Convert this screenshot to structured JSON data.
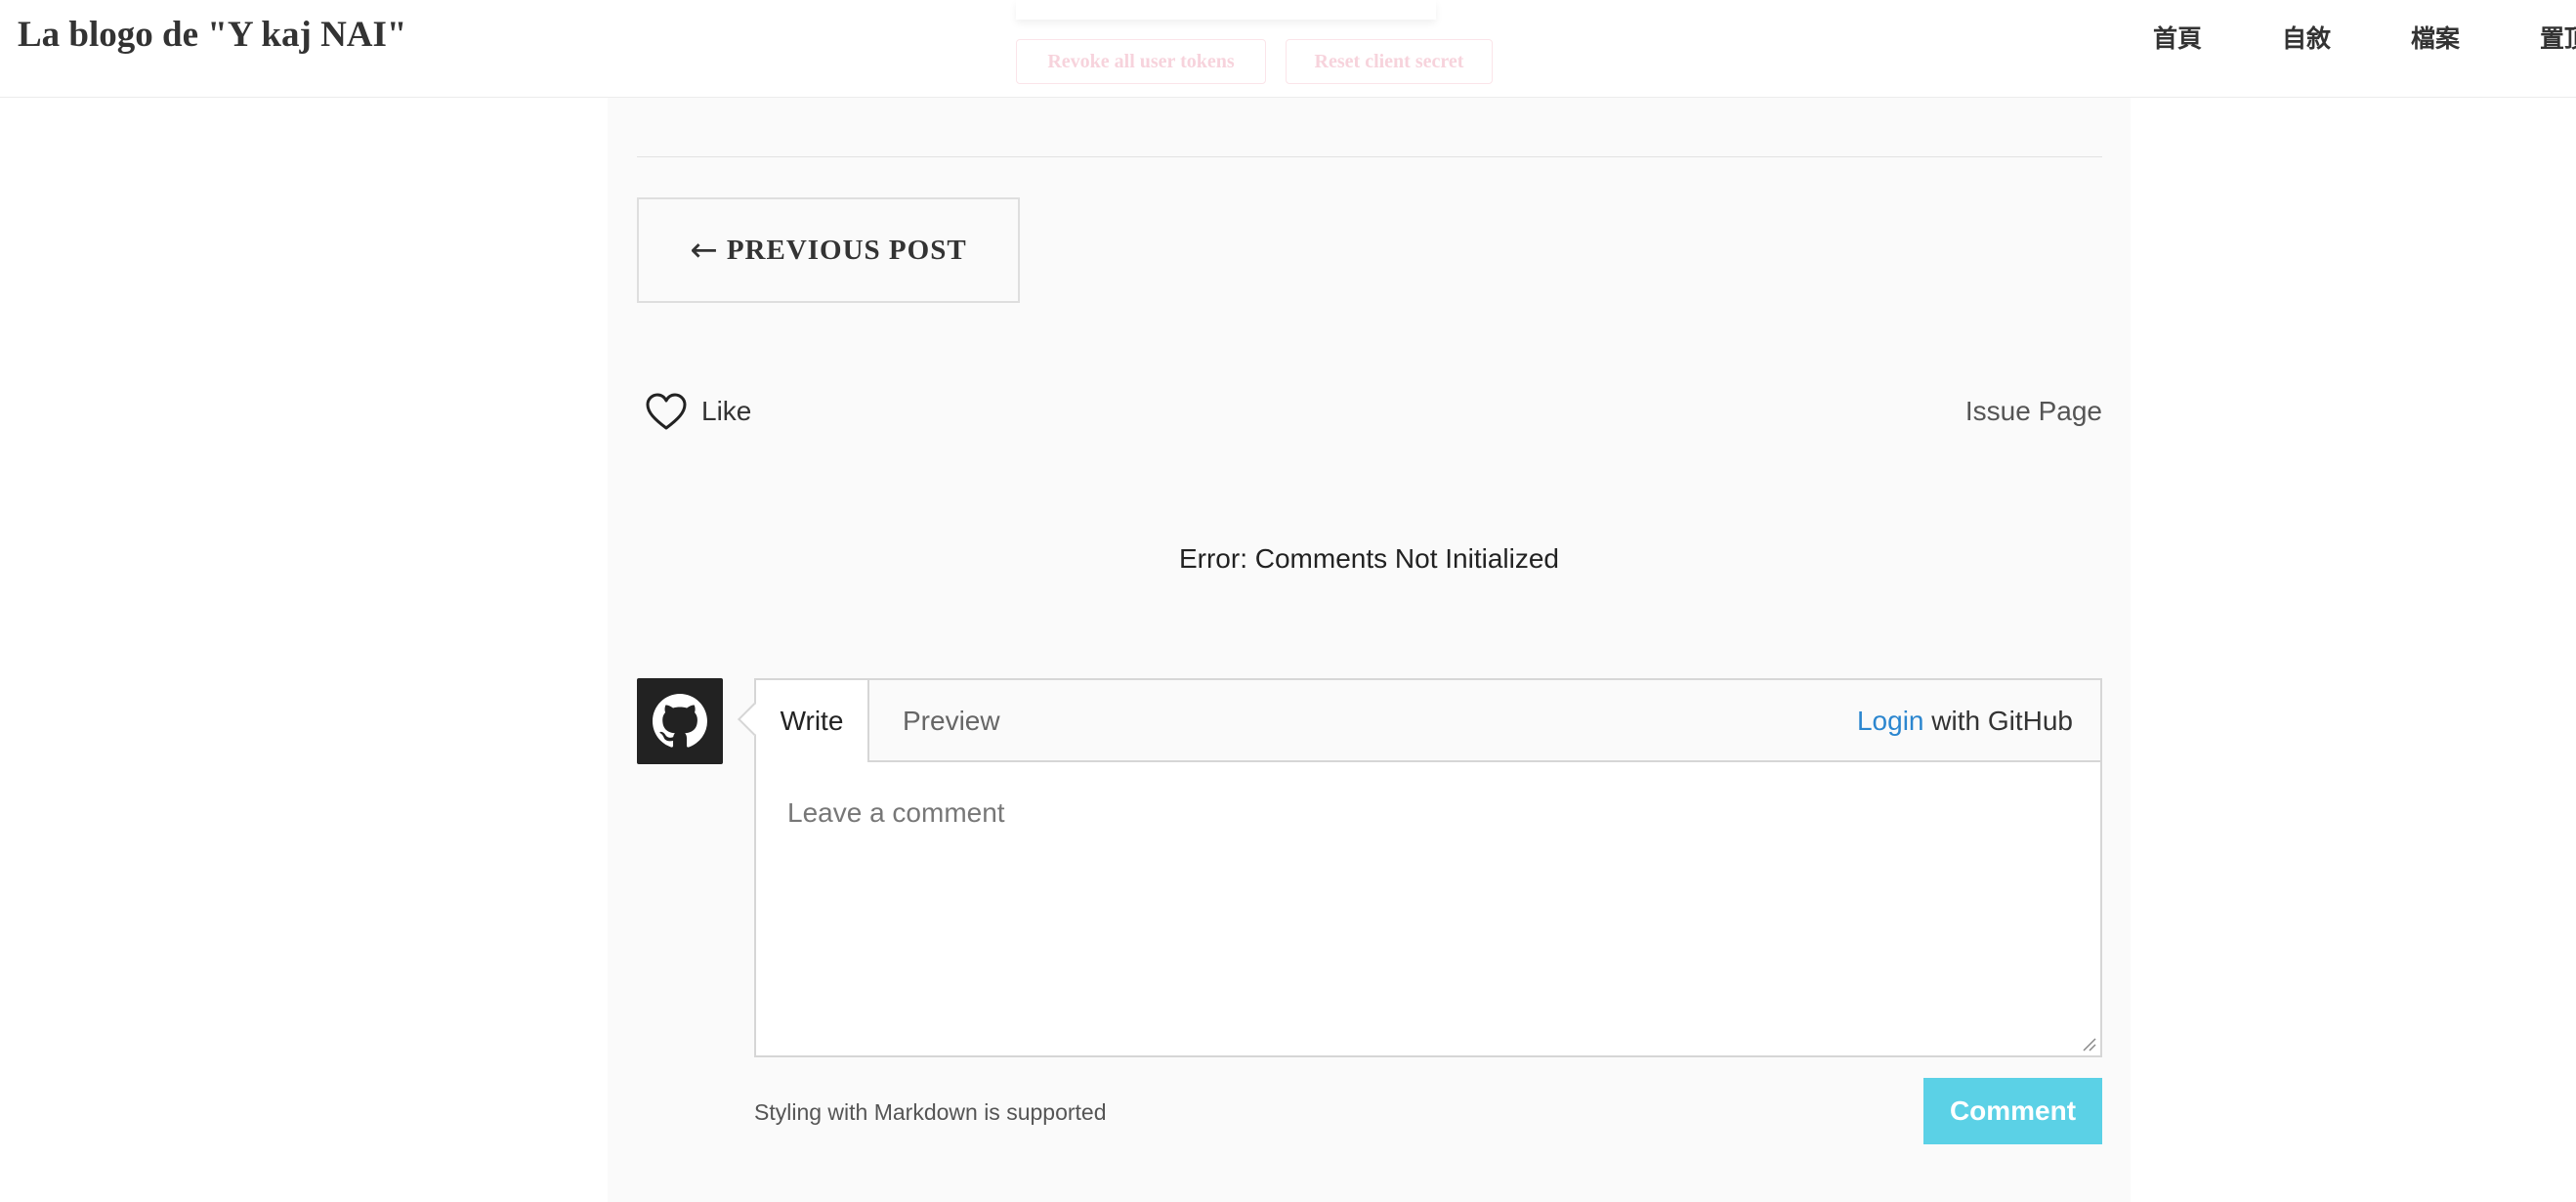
{
  "header": {
    "site_title": "La blogo de \"Y kaj NAI\"",
    "nav": [
      "首頁",
      "自敘",
      "檔案",
      "置頂"
    ]
  },
  "overlay": {
    "revoke_label": "Revoke all user tokens",
    "reset_label": "Reset client secret"
  },
  "post_nav": {
    "arrow": "←",
    "previous_label": "PREVIOUS POST"
  },
  "reactions": {
    "icon": "heart-outline-icon",
    "like_label": "Like",
    "issue_page_label": "Issue Page"
  },
  "comments": {
    "error": "Error: Comments Not Initialized",
    "avatar_icon": "github-icon",
    "tab_write": "Write",
    "tab_preview": "Preview",
    "login_link": "Login",
    "login_suffix": "with GitHub",
    "placeholder": "Leave a comment",
    "markdown_note": "Styling with Markdown is supported",
    "submit_label": "Comment"
  },
  "colors": {
    "accent": "#5bd1e6",
    "link": "#2b86cf",
    "avatar_bg": "#222222"
  }
}
